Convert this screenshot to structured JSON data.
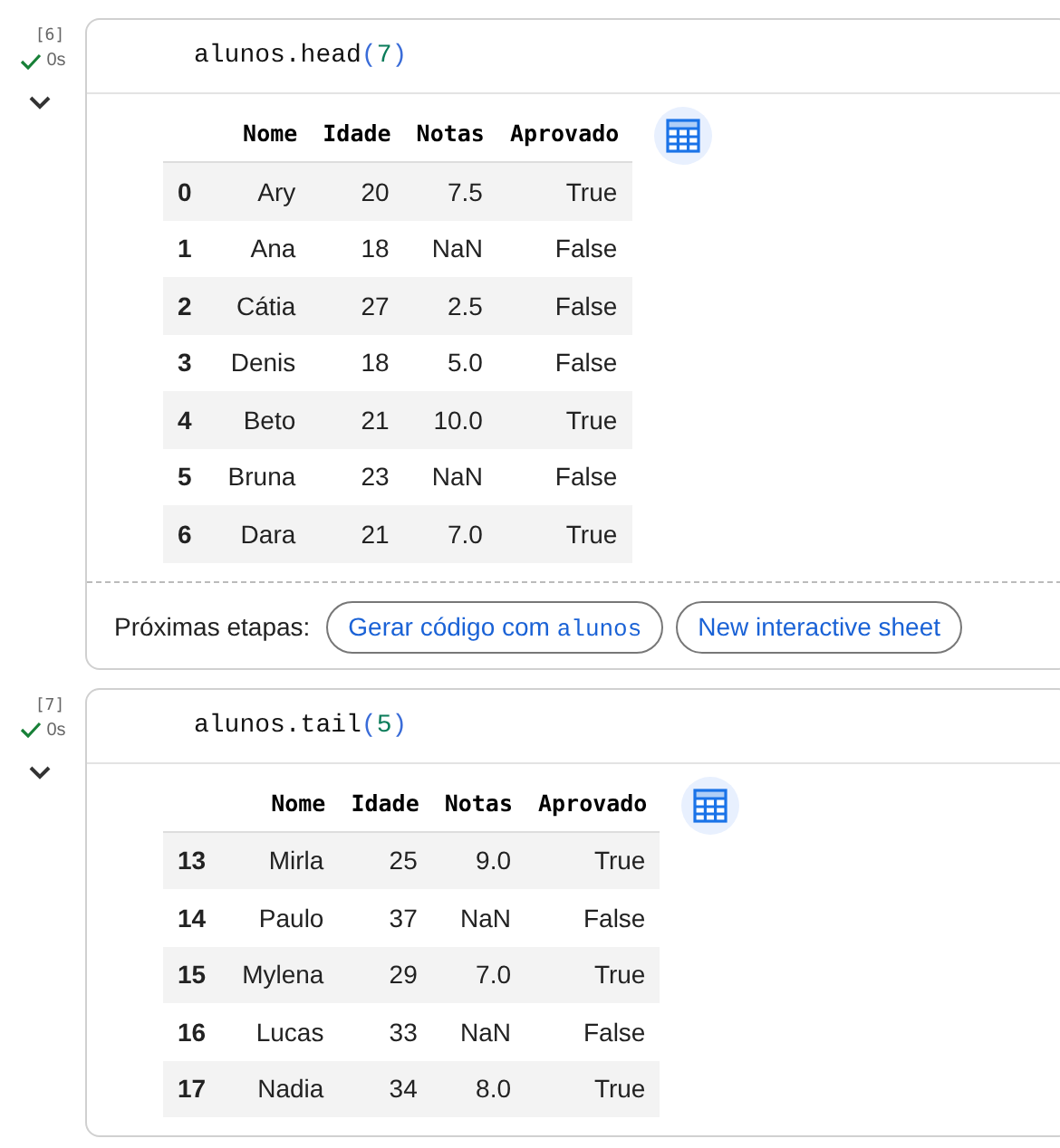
{
  "cells": [
    {
      "execution_count": "[6]",
      "status": "0s",
      "expanded": true,
      "code": [
        {
          "text": "alunos.head",
          "kind": "plain"
        },
        {
          "text": "(",
          "kind": "paren"
        },
        {
          "text": "7",
          "kind": "number"
        },
        {
          "text": ")",
          "kind": "paren"
        }
      ],
      "table": {
        "columns": [
          "Nome",
          "Idade",
          "Notas",
          "Aprovado"
        ],
        "rows": [
          {
            "index": "0",
            "cells": [
              "Ary",
              "20",
              "7.5",
              "True"
            ]
          },
          {
            "index": "1",
            "cells": [
              "Ana",
              "18",
              "NaN",
              "False"
            ]
          },
          {
            "index": "2",
            "cells": [
              "Cátia",
              "27",
              "2.5",
              "False"
            ]
          },
          {
            "index": "3",
            "cells": [
              "Denis",
              "18",
              "5.0",
              "False"
            ]
          },
          {
            "index": "4",
            "cells": [
              "Beto",
              "21",
              "10.0",
              "True"
            ]
          },
          {
            "index": "5",
            "cells": [
              "Bruna",
              "23",
              "NaN",
              "False"
            ]
          },
          {
            "index": "6",
            "cells": [
              "Dara",
              "21",
              "7.0",
              "True"
            ]
          }
        ]
      },
      "next_steps": {
        "label": "Próximas etapas:",
        "buttons": [
          [
            {
              "text": "Gerar código com ",
              "kind": "plain"
            },
            {
              "text": "alunos",
              "kind": "code"
            }
          ],
          [
            {
              "text": "New interactive sheet",
              "kind": "plain"
            }
          ]
        ]
      }
    },
    {
      "execution_count": "[7]",
      "status": "0s",
      "expanded": true,
      "code": [
        {
          "text": "alunos.tail",
          "kind": "plain"
        },
        {
          "text": "(",
          "kind": "paren"
        },
        {
          "text": "5",
          "kind": "number"
        },
        {
          "text": ")",
          "kind": "paren"
        }
      ],
      "table": {
        "columns": [
          "Nome",
          "Idade",
          "Notas",
          "Aprovado"
        ],
        "rows": [
          {
            "index": "13",
            "cells": [
              "Mirla",
              "25",
              "9.0",
              "True"
            ]
          },
          {
            "index": "14",
            "cells": [
              "Paulo",
              "37",
              "NaN",
              "False"
            ]
          },
          {
            "index": "15",
            "cells": [
              "Mylena",
              "29",
              "7.0",
              "True"
            ]
          },
          {
            "index": "16",
            "cells": [
              "Lucas",
              "33",
              "NaN",
              "False"
            ]
          },
          {
            "index": "17",
            "cells": [
              "Nadia",
              "34",
              "8.0",
              "True"
            ]
          }
        ]
      }
    }
  ]
}
